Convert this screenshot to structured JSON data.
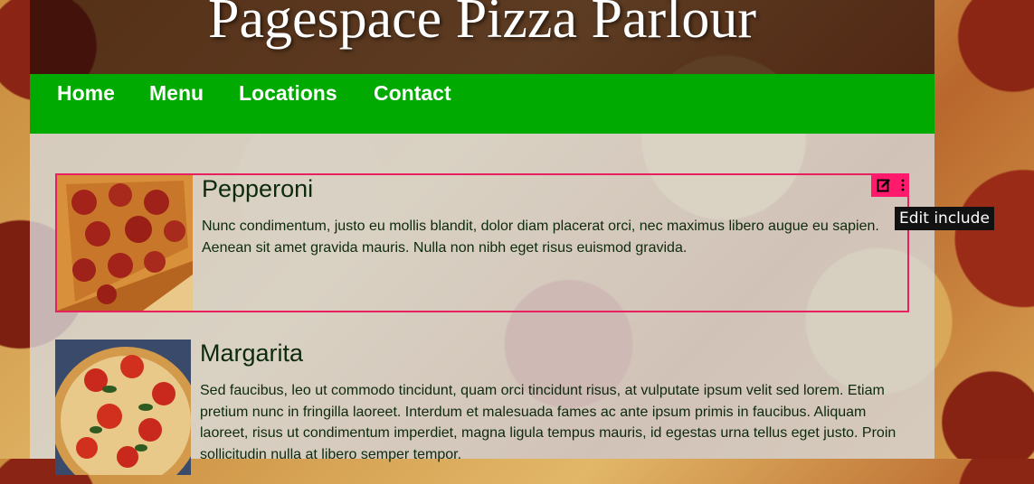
{
  "header": {
    "site_title": "Pagespace Pizza Parlour"
  },
  "nav": {
    "items": [
      {
        "label": "Home"
      },
      {
        "label": "Menu"
      },
      {
        "label": "Locations"
      },
      {
        "label": "Contact"
      }
    ]
  },
  "menu_items": [
    {
      "title": "Pepperoni",
      "description": "Nunc condimentum, justo eu mollis blandit, dolor diam placerat orci, nec maximus libero augue eu sapien. Aenean sit amet gravida mauris. Nulla non nibh eget risus euismod gravida."
    },
    {
      "title": "Margarita",
      "description": "Sed faucibus, leo ut commodo tincidunt, quam orci tincidunt risus, at vulputate ipsum velit sed lorem. Etiam pretium nunc in fringilla laoreet. Interdum et malesuada fames ac ante ipsum primis in faucibus. Aliquam laoreet, risus ut condimentum imperdiet, magna ligula tempus mauris, id egestas urna tellus eget justo. Proin sollicitudin nulla at libero semper tempor."
    }
  ],
  "editor": {
    "edit_icon": "edit-icon",
    "more_icon": "more-vertical-icon",
    "tooltip": "Edit include",
    "highlight_color": "#e8205e",
    "toolbar_color": "#ff1a6c"
  },
  "colors": {
    "nav_green": "#00aa00",
    "text_dark_green": "#0d2a0d"
  }
}
